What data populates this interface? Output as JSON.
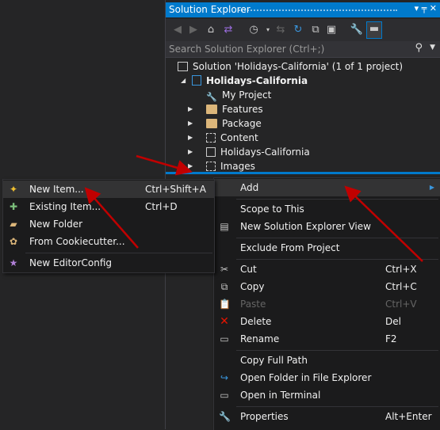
{
  "solution_explorer": {
    "title": "Solution Explorer",
    "pin_label": "▾ ╤ ✕",
    "search_placeholder": "Search Solution Explorer (Ctrl+;)",
    "tree": [
      {
        "label": "Solution 'Holidays-California' (1 of 1 project)",
        "icon": "solution-icon"
      },
      {
        "label": "Holidays-California",
        "icon": "project-icon",
        "bold": true
      },
      {
        "label": "My Project",
        "icon": "wrench-icon"
      },
      {
        "label": "Features",
        "icon": "folder-icon"
      },
      {
        "label": "Package",
        "icon": "folder-icon"
      },
      {
        "label": "Content",
        "icon": "content-icon"
      },
      {
        "label": "Holidays-California",
        "icon": "module-icon"
      },
      {
        "label": "Images",
        "icon": "images-icon"
      }
    ]
  },
  "context_menu": {
    "items": [
      {
        "label": "Add",
        "shortcut": ""
      },
      {
        "label": "Scope to This",
        "shortcut": ""
      },
      {
        "label": "New Solution Explorer View",
        "shortcut": ""
      },
      {
        "label": "Exclude From Project",
        "shortcut": ""
      },
      {
        "label": "Cut",
        "shortcut": "Ctrl+X"
      },
      {
        "label": "Copy",
        "shortcut": "Ctrl+C"
      },
      {
        "label": "Paste",
        "shortcut": "Ctrl+V"
      },
      {
        "label": "Delete",
        "shortcut": "Del"
      },
      {
        "label": "Rename",
        "shortcut": "F2"
      },
      {
        "label": "Copy Full Path",
        "shortcut": ""
      },
      {
        "label": "Open Folder in File Explorer",
        "shortcut": ""
      },
      {
        "label": "Open in Terminal",
        "shortcut": ""
      },
      {
        "label": "Properties",
        "shortcut": "Alt+Enter"
      }
    ]
  },
  "submenu": {
    "items": [
      {
        "label": "New Item...",
        "shortcut": "Ctrl+Shift+A"
      },
      {
        "label": "Existing Item...",
        "shortcut": "Ctrl+D"
      },
      {
        "label": "New Folder",
        "shortcut": ""
      },
      {
        "label": "From Cookiecutter...",
        "shortcut": ""
      },
      {
        "label": "New EditorConfig",
        "shortcut": ""
      }
    ]
  },
  "colors": {
    "accent": "#007acc",
    "arrow": "#c00000",
    "folder": "#dcb67a",
    "delete": "#e51400"
  }
}
